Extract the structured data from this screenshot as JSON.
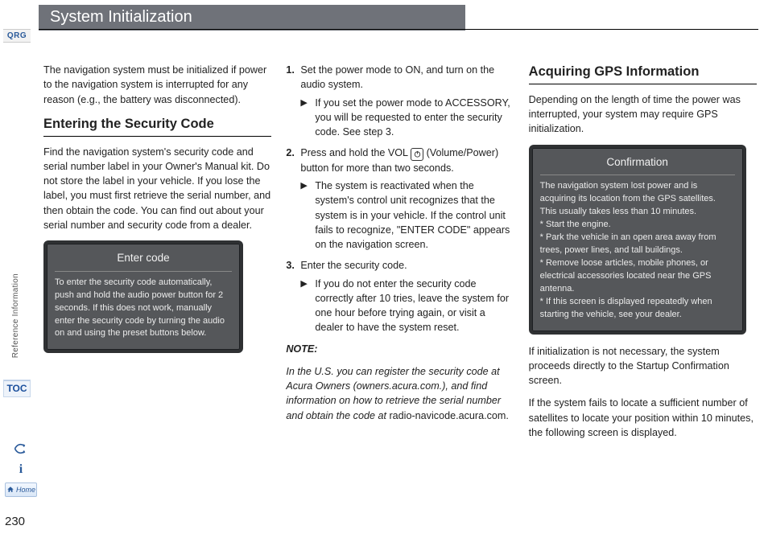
{
  "page_number": "230",
  "left_rail": {
    "qrg": "QRG",
    "section_label": "Reference Information",
    "toc": "TOC",
    "home": "Home"
  },
  "title": "System Initialization",
  "col1": {
    "intro": "The navigation system must be initialized if power to the navigation system is interrupted for any reason (e.g., the battery was disconnected).",
    "h_security": "Entering the Security Code",
    "security_body": "Find the navigation system's security code and serial number label in your Owner's Manual kit. Do not store the label in your vehicle. If you lose the label, you must first retrieve the serial number, and then obtain the code. You can find out about your serial number and security code from a dealer.",
    "screen": {
      "title": "Enter code",
      "body": "To enter the security code automatically, push and hold the audio power button for 2 seconds. If this does not work, manually enter the security code by turning the audio on and using the preset buttons below."
    }
  },
  "col2": {
    "steps": [
      {
        "num": "1.",
        "text": "Set the power mode to ON, and turn on the audio system.",
        "sub": "If you set the power mode to ACCESSORY, you will be requested to enter the security code. See step 3."
      },
      {
        "num": "2.",
        "text_a": "Press and hold the VOL ",
        "text_b": " (Volume/Power) button for more than two seconds.",
        "sub": "The system is reactivated when the system's control unit recognizes that the system is in your vehicle. If the control unit fails to recognize, \"ENTER CODE\" appears on the navigation screen."
      },
      {
        "num": "3.",
        "text": "Enter the security code.",
        "sub": "If you do not enter the security code correctly after 10 tries, leave the system for one hour before trying again, or visit a dealer to have the system reset."
      }
    ],
    "note_head": "NOTE:",
    "note_body_a": "In the U.S. you can register the security code at Acura Owners (owners.acura.com.), and find information on how to retrieve the serial number and obtain the code at ",
    "note_body_b": "radio-navicode.acura.com",
    "note_body_c": "."
  },
  "col3": {
    "h_gps": "Acquiring GPS Information",
    "gps_body": "Depending on the length of time the power was interrupted, your system may require GPS initialization.",
    "screen": {
      "title": "Confirmation",
      "body": "The navigation system lost power and is acquiring its location from the GPS satellites.\nThis usually takes less than 10 minutes.\n* Start the engine.\n* Park the vehicle in an open area away from trees, power lines, and tall buildings.\n* Remove loose articles, mobile phones, or electrical accessories located near the GPS antenna.\n* If this screen is displayed repeatedly when starting the vehicle, see your dealer."
    },
    "after1": "If initialization is not necessary, the system proceeds directly to the Startup Confirmation screen.",
    "after2": "If the system fails to locate a sufficient number of satellites to locate your position within 10 minutes, the following screen is displayed."
  }
}
